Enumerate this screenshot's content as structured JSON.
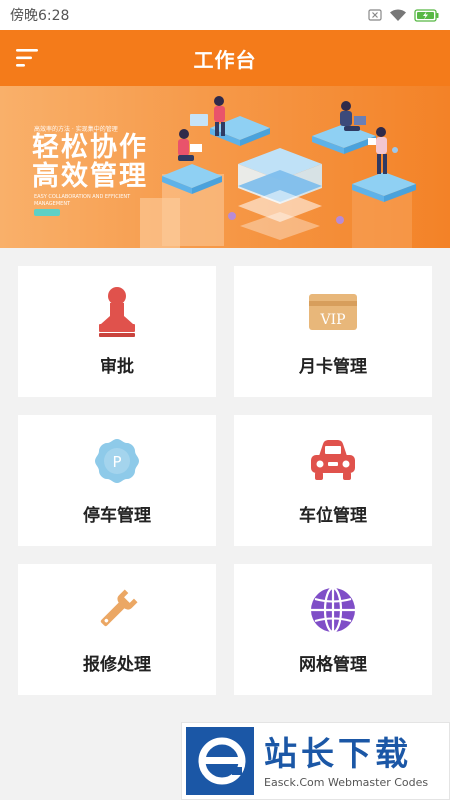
{
  "status_bar": {
    "time": "傍晚6:28",
    "icons": [
      "sim-icon",
      "wifi-icon",
      "battery-icon"
    ]
  },
  "header": {
    "title": "工作台",
    "menu_icon": "hamburger-menu-icon",
    "color": "#f47b1a"
  },
  "banner": {
    "tagline": "高效率的方法 · 实现集中的管理",
    "line1": "轻松协作",
    "line2": "高效管理",
    "subtitle": "EASY COLLABORATION AND EFFICIENT MANAGEMENT"
  },
  "grid": {
    "items": [
      {
        "label": "审批",
        "icon": "approval-stamp-icon",
        "color": "#e0524c"
      },
      {
        "label": "月卡管理",
        "icon": "vip-card-icon",
        "color": "#e8b77a"
      },
      {
        "label": "停车管理",
        "icon": "parking-icon",
        "color": "#8ecae9"
      },
      {
        "label": "车位管理",
        "icon": "car-icon",
        "color": "#e0524c"
      },
      {
        "label": "报修处理",
        "icon": "wrench-icon",
        "color": "#eba764"
      },
      {
        "label": "网格管理",
        "icon": "globe-grid-icon",
        "color": "#7f4ec7"
      }
    ]
  },
  "watermark": {
    "title": "站长下载",
    "subtitle": "Easck.Com Webmaster Codes",
    "brand_color": "#1b57a6"
  }
}
